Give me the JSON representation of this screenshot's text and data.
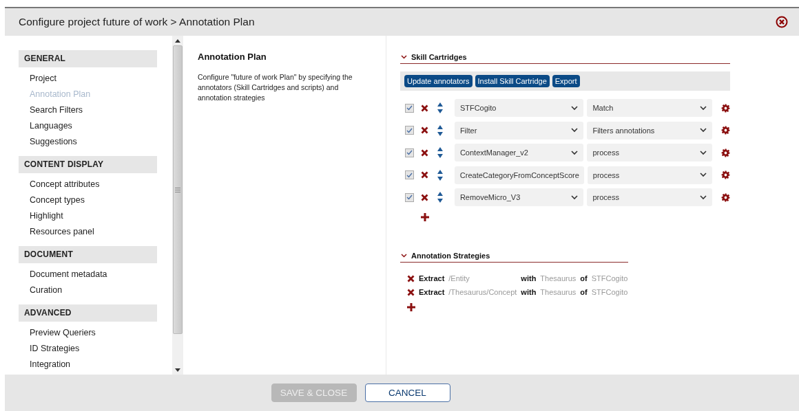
{
  "window": {
    "title": "Configure project future of work > Annotation Plan"
  },
  "sidebar": {
    "sections": [
      {
        "title": "GENERAL",
        "items": [
          {
            "label": "Project",
            "selected": false
          },
          {
            "label": "Annotation Plan",
            "selected": true
          },
          {
            "label": "Search Filters",
            "selected": false
          },
          {
            "label": "Languages",
            "selected": false
          },
          {
            "label": "Suggestions",
            "selected": false
          }
        ]
      },
      {
        "title": "CONTENT DISPLAY",
        "items": [
          {
            "label": "Concept attributes",
            "selected": false
          },
          {
            "label": "Concept types",
            "selected": false
          },
          {
            "label": "Highlight",
            "selected": false
          },
          {
            "label": "Resources panel",
            "selected": false
          }
        ]
      },
      {
        "title": "DOCUMENT",
        "items": [
          {
            "label": "Document metadata",
            "selected": false
          },
          {
            "label": "Curation",
            "selected": false
          }
        ]
      },
      {
        "title": "ADVANCED",
        "items": [
          {
            "label": "Preview Queriers",
            "selected": false
          },
          {
            "label": "ID Strategies",
            "selected": false
          },
          {
            "label": "Integration",
            "selected": false
          }
        ]
      }
    ]
  },
  "content": {
    "heading": "Annotation Plan",
    "description": "Configure \"future of work Plan\" by specifying the annotators (Skill Cartridges and scripts) and annotation strategies"
  },
  "skill_cartridges": {
    "title": "Skill Cartridges",
    "expanded": true,
    "buttons": [
      "Update annotators",
      "Install Skill Cartridge",
      "Export"
    ],
    "rows": [
      {
        "checked": true,
        "annotator": "STFCogito",
        "function": "Match"
      },
      {
        "checked": true,
        "annotator": "Filter",
        "function": "Filters annotations"
      },
      {
        "checked": true,
        "annotator": "ContextManager_v2",
        "function": "process"
      },
      {
        "checked": true,
        "annotator": "CreateCategoryFromConceptScore",
        "function": "process"
      },
      {
        "checked": true,
        "annotator": "RemoveMicro_V3",
        "function": "process"
      }
    ]
  },
  "annotation_strategies": {
    "title": "Annotation Strategies",
    "expanded": true,
    "rows": [
      {
        "action": "Extract",
        "path": "/Entity",
        "with_label": "with",
        "source": "Thesaurus",
        "of_label": "of",
        "target": "STFCogito"
      },
      {
        "action": "Extract",
        "path": "/Thesaurus/Concept",
        "with_label": "with",
        "source": "Thesaurus",
        "of_label": "of",
        "target": "STFCogito"
      }
    ]
  },
  "footer": {
    "buttons": [
      {
        "label": "SAVE & CLOSE",
        "disabled": true
      },
      {
        "label": "CANCEL",
        "disabled": false
      }
    ]
  }
}
